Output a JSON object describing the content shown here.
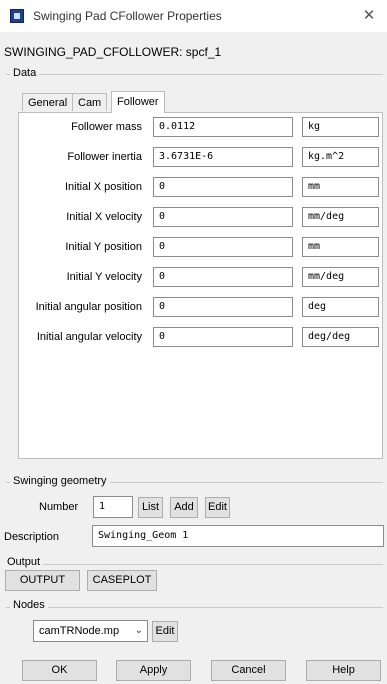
{
  "window": {
    "title": "Swinging Pad CFollower Properties",
    "close_glyph": "✕",
    "app_icon": "app-icon"
  },
  "header": {
    "label": "SWINGING_PAD_CFOLLOWER: spcf_1"
  },
  "data_group": {
    "label": "Data",
    "tabs": [
      {
        "label": "General",
        "active": false
      },
      {
        "label": "Cam",
        "active": false
      },
      {
        "label": "Follower",
        "active": true
      }
    ],
    "fields": [
      {
        "label": "Follower mass",
        "value": "0.0112",
        "unit": "kg"
      },
      {
        "label": "Follower inertia",
        "value": "3.6731E-6",
        "unit": "kg.m^2"
      },
      {
        "label": "Initial X position",
        "value": "0",
        "unit": "mm"
      },
      {
        "label": "Initial X velocity",
        "value": "0",
        "unit": "mm/deg"
      },
      {
        "label": "Initial Y position",
        "value": "0",
        "unit": "mm"
      },
      {
        "label": "Initial Y velocity",
        "value": "0",
        "unit": "mm/deg"
      },
      {
        "label": "Initial angular position",
        "value": "0",
        "unit": "deg"
      },
      {
        "label": "Initial angular velocity",
        "value": "0",
        "unit": "deg/deg"
      }
    ]
  },
  "swinging_geometry": {
    "label": "Swinging geometry",
    "number_label": "Number",
    "number_value": "1",
    "list_label": "List",
    "add_label": "Add",
    "edit_label": "Edit",
    "description_label": "Description",
    "description_value": "Swinging_Geom 1"
  },
  "output": {
    "label": "Output",
    "output_button": "OUTPUT",
    "caseplot_button": "CASEPLOT"
  },
  "nodes": {
    "label": "Nodes",
    "selected": "camTRNode.mp",
    "edit_label": "Edit"
  },
  "footer": {
    "ok": "OK",
    "apply": "Apply",
    "cancel": "Cancel",
    "help": "Help"
  }
}
